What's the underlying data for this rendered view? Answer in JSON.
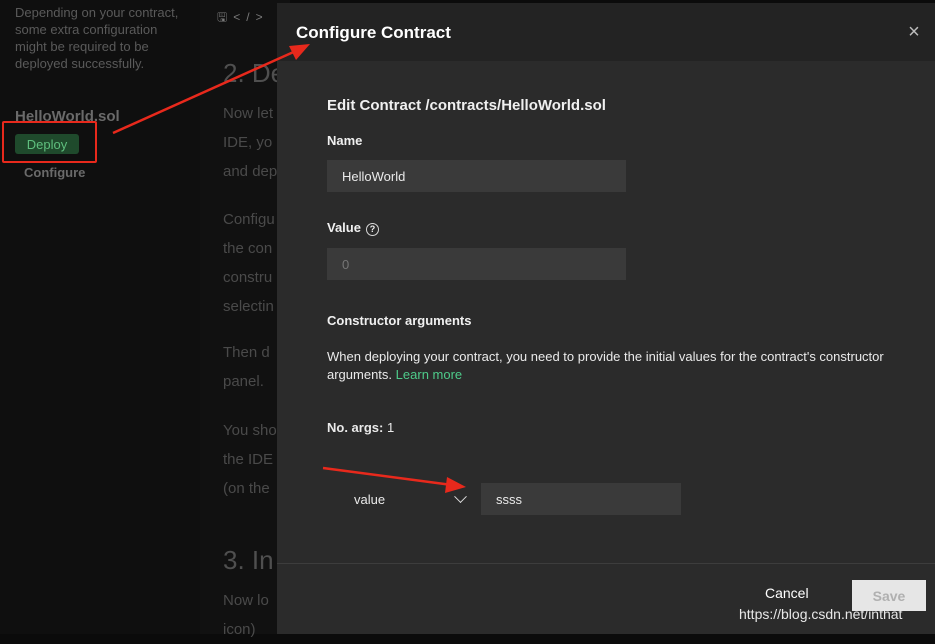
{
  "sidebar": {
    "description": "Depending on your contract, some extra configuration might be required to be deployed successfully.",
    "file_name": "HelloWorld.sol",
    "deploy_label": "Deploy",
    "configure_label": "Configure"
  },
  "doc": {
    "heading_2": "2. De",
    "heading_3": "3. In",
    "p1": [
      "Now let",
      "IDE, yo",
      "and dep"
    ],
    "p2": [
      "Configu",
      "the con",
      "constru",
      "selectin"
    ],
    "p3": [
      "Then d",
      "panel."
    ],
    "p4": [
      "You sho",
      "the IDE",
      "(on the"
    ],
    "p5": [
      "Now lo",
      "icon)"
    ]
  },
  "modal": {
    "title": "Configure Contract",
    "close": "×",
    "section_title": "Edit Contract /contracts/HelloWorld.sol",
    "name_label": "Name",
    "name_value": "HelloWorld",
    "value_label": "Value",
    "help_icon": "?",
    "value_placeholder": "0",
    "constructor_title": "Constructor arguments",
    "constructor_text": "When deploying your contract, you need to provide the initial values for the contract's constructor arguments.",
    "learn_more": "Learn more",
    "args_label": "No. args:",
    "args_count": "1",
    "arg_type": "value",
    "arg_value": "ssss",
    "cancel_label": "Cancel",
    "save_label": "Save"
  },
  "watermark": "https://blog.csdn.net/inthat",
  "colors": {
    "accent_green": "#4ecb8a",
    "annotation_red": "#e8291c",
    "modal_bg": "#2b2b2b"
  }
}
